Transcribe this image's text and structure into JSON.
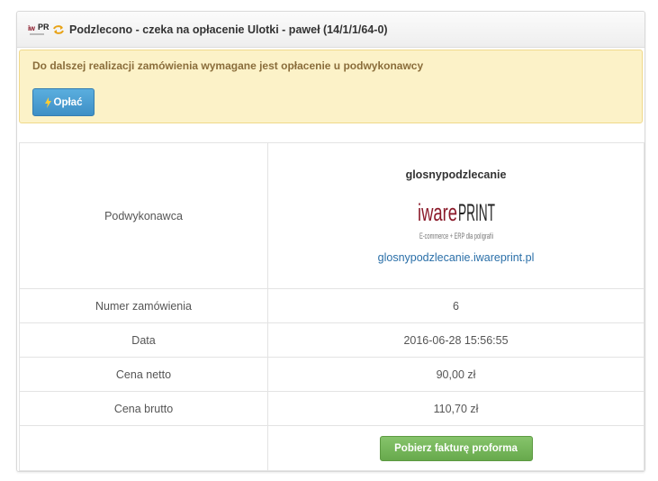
{
  "header": {
    "title": "Podzlecono - czeka na opłacenie Ulotki - paweł (14/1/1/64-0)",
    "logo_text": "iwarePRINT"
  },
  "alert": {
    "message": "Do dalszej realizacji zamówienia wymagane jest opłacenie u podwykonawcy",
    "pay_label": "Opłać"
  },
  "details": {
    "subcontractor": {
      "label": "Podwykonawca",
      "name": "glosnypodzlecanie",
      "logo_text": "iwarePRINT",
      "logo_tagline": "E-commerce + ERP dla poligrafii",
      "url": "glosnypodzlecanie.iwareprint.pl"
    },
    "rows": [
      {
        "label": "Numer zamówienia",
        "value": "6"
      },
      {
        "label": "Data",
        "value": "2016-06-28 15:56:55"
      },
      {
        "label": "Cena netto",
        "value": "90,00 zł"
      },
      {
        "label": "Cena brutto",
        "value": "110,70 zł"
      }
    ],
    "invoice_button": "Pobierz fakturę proforma"
  },
  "colors": {
    "alert_bg": "#fcf2c8",
    "alert_text": "#8a6d3b",
    "pay_button": "#4a9fd5",
    "invoice_button": "#74b658",
    "link": "#2a6fa8",
    "logo_red": "#8b1a2a"
  }
}
